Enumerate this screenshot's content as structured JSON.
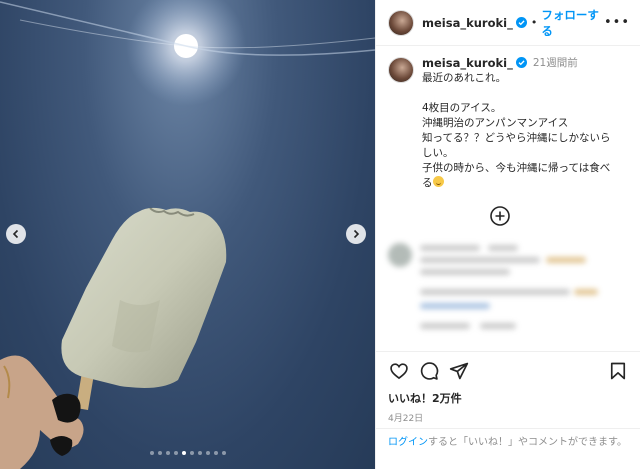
{
  "post": {
    "username": "meisa_kuroki_",
    "follow_label": "フォローする",
    "separator": "•",
    "more_label": "•••",
    "posted_ago": "21週間前",
    "caption_lines": [
      "最近のあれこれ。",
      "",
      "4枚目のアイス。",
      "沖縄明治のアンパンマンアイス",
      "知ってる？？どうやら沖縄にしかないらしい。",
      "子供の時から、今も沖縄に帰っては食べる"
    ],
    "likes": "いいね！2万件",
    "date": "4月22日",
    "login_link": "ログイン",
    "login_text": "すると「いいね！」やコメントができます。"
  },
  "carousel": {
    "total": 10,
    "active_index": 4
  },
  "icons": {
    "verified": "verified-badge-icon",
    "more": "more-options-icon",
    "load_more": "load-more-comments-icon",
    "like": "heart-icon",
    "comment": "comment-icon",
    "share": "share-icon",
    "save": "bookmark-icon",
    "prev": "chevron-left-icon",
    "next": "chevron-right-icon"
  },
  "colors": {
    "accent": "#0095f6",
    "text": "#262626",
    "muted": "#8e8e8e",
    "sky": "#2e4464"
  }
}
